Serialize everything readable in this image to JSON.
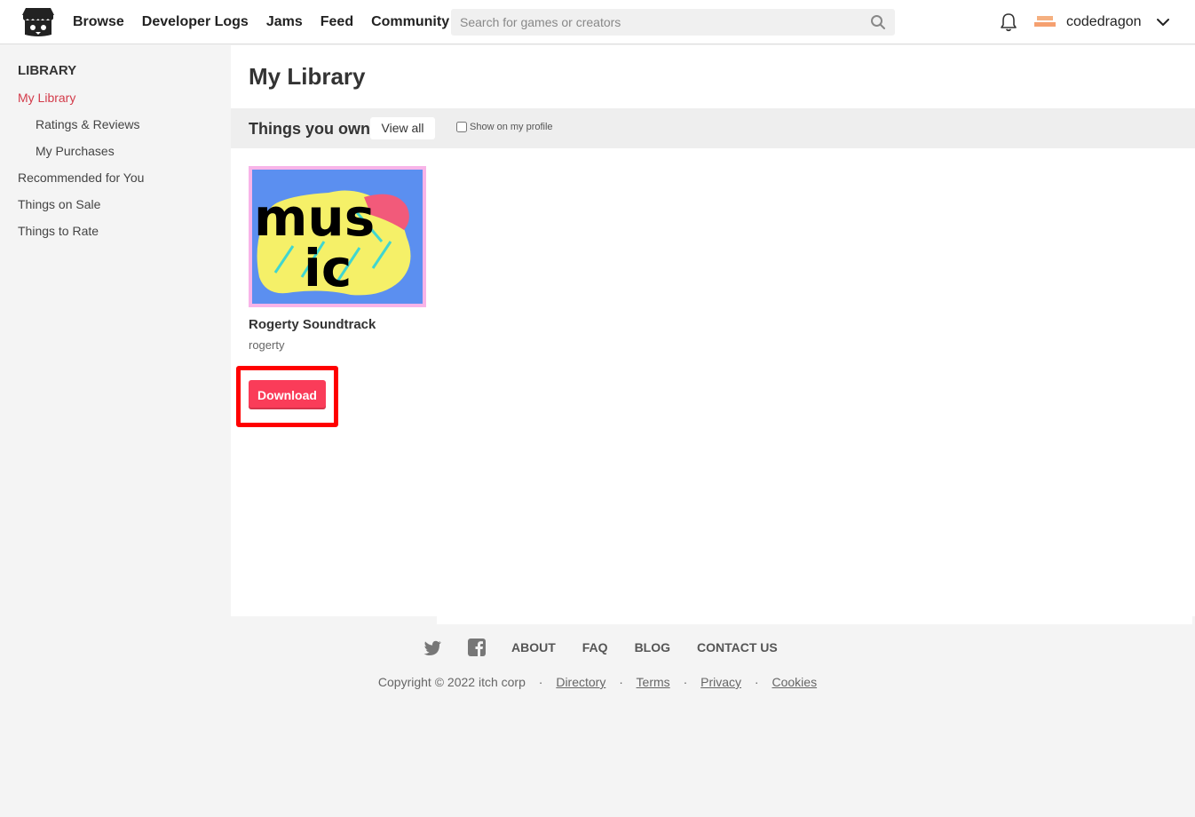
{
  "header": {
    "nav": [
      "Browse",
      "Developer Logs",
      "Jams",
      "Feed",
      "Community"
    ],
    "search_placeholder": "Search for games or creators",
    "avatar_text": "codedragon avatar",
    "username": "codedragon"
  },
  "sidebar": {
    "heading": "LIBRARY",
    "items": [
      "My Library",
      "Ratings & Reviews",
      "My Purchases",
      "Recommended for You",
      "Things on Sale",
      "Things to Rate"
    ]
  },
  "main": {
    "title": "My Library",
    "section_title": "Things you own",
    "view_all": "View all",
    "show_profile": "Show on my profile",
    "game": {
      "title": "Rogerty Soundtrack",
      "author": "rogerty",
      "cover_text": [
        "mus",
        "ic"
      ],
      "download": "Download"
    }
  },
  "footer": {
    "links": [
      "ABOUT",
      "FAQ",
      "BLOG",
      "CONTACT US"
    ],
    "copyright": "Copyright © 2022 itch corp",
    "legal": [
      "Directory",
      "Terms",
      "Privacy",
      "Cookies"
    ]
  },
  "colors": {
    "accent": "#d33b4a",
    "download": "#fa3c59",
    "highlight": "#ff0000"
  }
}
